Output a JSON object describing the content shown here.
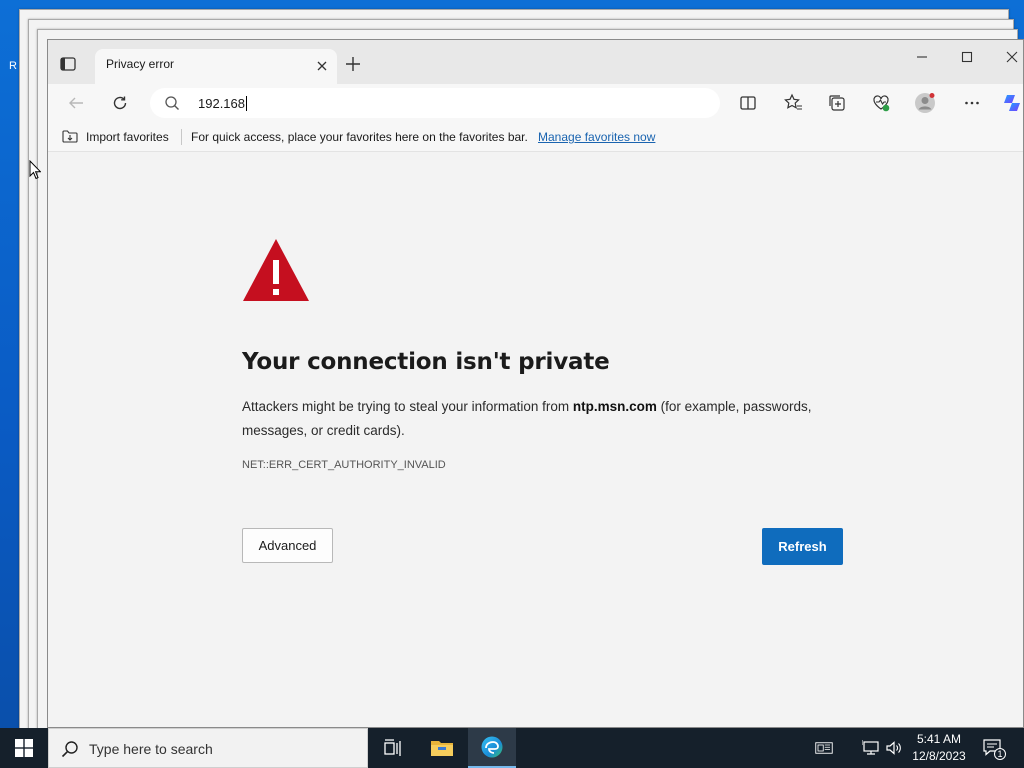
{
  "desktop": {
    "edge_letter": "R"
  },
  "browser": {
    "tab": {
      "title": "Privacy error"
    },
    "address_bar": {
      "value": "192.168"
    },
    "favorites_bar": {
      "import_label": "Import favorites",
      "message": "For quick access, place your favorites here on the favorites bar.",
      "manage_link": "Manage favorites now"
    },
    "error_page": {
      "title": "Your connection isn't private",
      "desc_prefix": "Attackers might be trying to steal your information from ",
      "desc_host": "ntp.msn.com",
      "desc_suffix": " (for example, passwords, messages, or credit cards).",
      "error_code": "NET::ERR_CERT_AUTHORITY_INVALID",
      "advanced_button": "Advanced",
      "refresh_button": "Refresh"
    },
    "colors": {
      "accent": "#0f6cbd",
      "warning": "#c50f1f"
    }
  },
  "taskbar": {
    "search_placeholder": "Type here to search",
    "time": "5:41 AM",
    "date": "12/8/2023",
    "notification_count": "1"
  }
}
